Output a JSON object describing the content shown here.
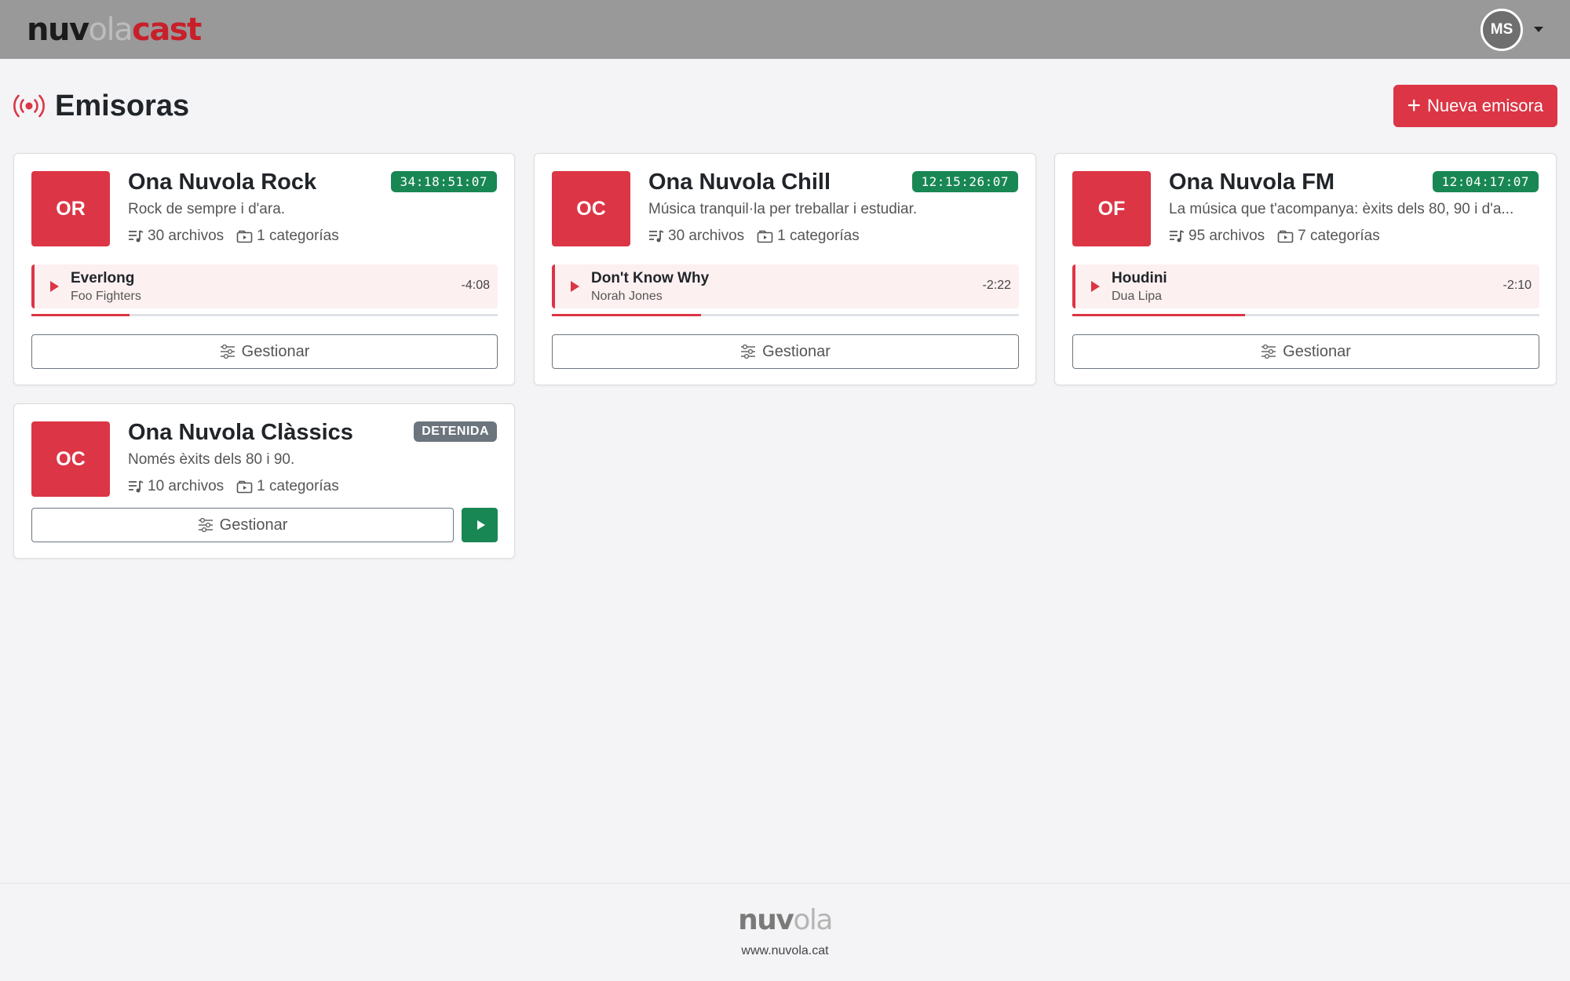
{
  "brand": {
    "part1": "nuv",
    "part2": "ola",
    "part3": "cast"
  },
  "user": {
    "initials": "MS"
  },
  "page": {
    "title": "Emisoras",
    "new_button": "Nueva emisora"
  },
  "stations": [
    {
      "initials": "OR",
      "name": "Ona Nuvola Rock",
      "description": "Rock de sempre i d'ara.",
      "files": "30 archivos",
      "categories": "1 categorías",
      "status": "34:18:51:07",
      "now_playing": {
        "title": "Everlong",
        "artist": "Foo Fighters",
        "remaining": "-4:08",
        "progress": 0.21
      },
      "manage": "Gestionar"
    },
    {
      "initials": "OC",
      "name": "Ona Nuvola Chill",
      "description": "Música tranquil·la per treballar i estudiar.",
      "files": "30 archivos",
      "categories": "1 categorías",
      "status": "12:15:26:07",
      "now_playing": {
        "title": "Don't Know Why",
        "artist": "Norah Jones",
        "remaining": "-2:22",
        "progress": 0.32
      },
      "manage": "Gestionar"
    },
    {
      "initials": "OF",
      "name": "Ona Nuvola FM",
      "description": "La música que t'acompanya: èxits dels 80, 90 i d'a...",
      "files": "95 archivos",
      "categories": "7 categorías",
      "status": "12:04:17:07",
      "now_playing": {
        "title": "Houdini",
        "artist": "Dua Lipa",
        "remaining": "-2:10",
        "progress": 0.37
      },
      "manage": "Gestionar"
    },
    {
      "initials": "OC",
      "name": "Ona Nuvola Clàssics",
      "description": "Només èxits dels 80 i 90.",
      "files": "10 archivos",
      "categories": "1 categorías",
      "status": "DETENIDA",
      "manage": "Gestionar"
    }
  ],
  "footer": {
    "logo_part1": "nuv",
    "logo_part2": "ola",
    "url": "www.nuvola.cat"
  },
  "colors": {
    "accent": "#dc3545",
    "success": "#198754",
    "muted": "#6c757d",
    "topbar": "#999999"
  },
  "icons": [
    "broadcast-icon",
    "playlist-icon",
    "folder-icon",
    "sliders-icon",
    "play-icon",
    "plus-icon",
    "chevron-down-icon"
  ]
}
